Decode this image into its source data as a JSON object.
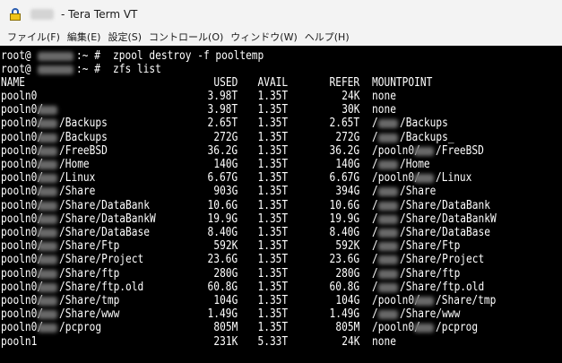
{
  "window": {
    "title": "- Tera Term VT",
    "app_icon": "lock-icon"
  },
  "menu": {
    "items": [
      {
        "label": "ファイル(F)"
      },
      {
        "label": "編集(E)"
      },
      {
        "label": "設定(S)"
      },
      {
        "label": "コントロール(O)"
      },
      {
        "label": "ウィンドウ(W)"
      },
      {
        "label": "ヘルプ(H)"
      }
    ]
  },
  "terminal": {
    "prompt_user": "root@",
    "prompt_suffix": ":~ #",
    "commands": [
      "zpool destroy -f pooltemp",
      "zfs list"
    ],
    "headers": {
      "name": "NAME",
      "used": "USED",
      "avail": "AVAIL",
      "refer": "REFER",
      "mountpoint": "MOUNTPOINT"
    },
    "rows": [
      {
        "name_pre": "pooln0",
        "name_post": "",
        "used": "3.98T",
        "avail": "1.35T",
        "refer": "24K",
        "mp_pre": "none",
        "mp_post": ""
      },
      {
        "name_pre": "pooln0/",
        "name_post": "",
        "used": "3.98T",
        "avail": "1.35T",
        "refer": "30K",
        "mp_pre": "none",
        "mp_post": ""
      },
      {
        "name_pre": "pooln0/",
        "name_post": "/Backups",
        "used": "2.65T",
        "avail": "1.35T",
        "refer": "2.65T",
        "mp_pre": "/",
        "mp_post": "/Backups"
      },
      {
        "name_pre": "pooln0/",
        "name_post": "/Backups",
        "used": "272G",
        "avail": "1.35T",
        "refer": "272G",
        "mp_pre": "/",
        "mp_post": "/Backups_"
      },
      {
        "name_pre": "pooln0/",
        "name_post": "/FreeBSD",
        "used": "36.2G",
        "avail": "1.35T",
        "refer": "36.2G",
        "mp_pre": "/pooln0/",
        "mp_post": "/FreeBSD"
      },
      {
        "name_pre": "pooln0/",
        "name_post": "/Home",
        "used": "140G",
        "avail": "1.35T",
        "refer": "140G",
        "mp_pre": "/",
        "mp_post": "/Home"
      },
      {
        "name_pre": "pooln0/",
        "name_post": "/Linux",
        "used": "6.67G",
        "avail": "1.35T",
        "refer": "6.67G",
        "mp_pre": "/pooln0/",
        "mp_post": "/Linux"
      },
      {
        "name_pre": "pooln0/",
        "name_post": "/Share",
        "used": "903G",
        "avail": "1.35T",
        "refer": "394G",
        "mp_pre": "/",
        "mp_post": "/Share"
      },
      {
        "name_pre": "pooln0/",
        "name_post": "/Share/DataBank",
        "used": "10.6G",
        "avail": "1.35T",
        "refer": "10.6G",
        "mp_pre": "/",
        "mp_post": "/Share/DataBank"
      },
      {
        "name_pre": "pooln0/",
        "name_post": "/Share/DataBankW",
        "used": "19.9G",
        "avail": "1.35T",
        "refer": "19.9G",
        "mp_pre": "/",
        "mp_post": "/Share/DataBankW"
      },
      {
        "name_pre": "pooln0/",
        "name_post": "/Share/DataBase",
        "used": "8.40G",
        "avail": "1.35T",
        "refer": "8.40G",
        "mp_pre": "/",
        "mp_post": "/Share/DataBase"
      },
      {
        "name_pre": "pooln0/",
        "name_post": "/Share/Ftp",
        "used": "592K",
        "avail": "1.35T",
        "refer": "592K",
        "mp_pre": "/",
        "mp_post": "/Share/Ftp"
      },
      {
        "name_pre": "pooln0/",
        "name_post": "/Share/Project",
        "used": "23.6G",
        "avail": "1.35T",
        "refer": "23.6G",
        "mp_pre": "/",
        "mp_post": "/Share/Project"
      },
      {
        "name_pre": "pooln0/",
        "name_post": "/Share/ftp",
        "used": "280G",
        "avail": "1.35T",
        "refer": "280G",
        "mp_pre": "/",
        "mp_post": "/Share/ftp"
      },
      {
        "name_pre": "pooln0/",
        "name_post": "/Share/ftp.old",
        "used": "60.8G",
        "avail": "1.35T",
        "refer": "60.8G",
        "mp_pre": "/",
        "mp_post": "/Share/ftp.old"
      },
      {
        "name_pre": "pooln0/",
        "name_post": "/Share/tmp",
        "used": "104G",
        "avail": "1.35T",
        "refer": "104G",
        "mp_pre": "/pooln0/",
        "mp_post": "/Share/tmp"
      },
      {
        "name_pre": "pooln0/",
        "name_post": "/Share/www",
        "used": "1.49G",
        "avail": "1.35T",
        "refer": "1.49G",
        "mp_pre": "/",
        "mp_post": "/Share/www"
      },
      {
        "name_pre": "pooln0/",
        "name_post": "/pcprog",
        "used": "805M",
        "avail": "1.35T",
        "refer": "805M",
        "mp_pre": "/pooln0/",
        "mp_post": "/pcprog"
      },
      {
        "name_pre": "pooln1",
        "name_post": "",
        "used": "231K",
        "avail": "5.33T",
        "refer": "24K",
        "mp_pre": "none",
        "mp_post": ""
      }
    ]
  },
  "colors": {
    "terminal_bg": "#000000",
    "terminal_fg": "#ffffff",
    "chrome_bg": "#f3f3f3",
    "redaction": "#6a6a6a"
  }
}
